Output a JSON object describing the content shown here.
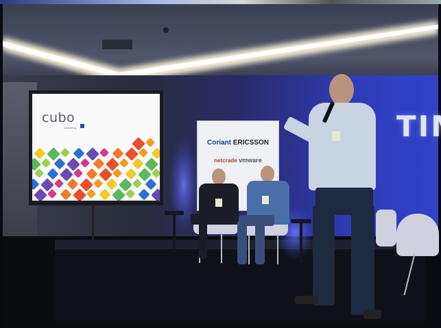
{
  "screen": {
    "logo": "cubo",
    "logo_sub": "coworking"
  },
  "sign": {
    "brands_row1": [
      "Coriant",
      "ERICSSON"
    ],
    "brands_row2": [
      "netcrade",
      "vmware"
    ]
  },
  "wall_text": "TIM",
  "colors": {
    "stage_light": "#3142c8",
    "screen_bg": "#fafafa",
    "ceiling_light": "#fff4d8"
  },
  "tile_colors": [
    "#e84f2b",
    "#f39b1a",
    "#f5c923",
    "#5cb85c",
    "#9ad04b",
    "#2a6fd6",
    "#6a4bb5",
    "#d23a8a",
    "#f07a2a"
  ]
}
